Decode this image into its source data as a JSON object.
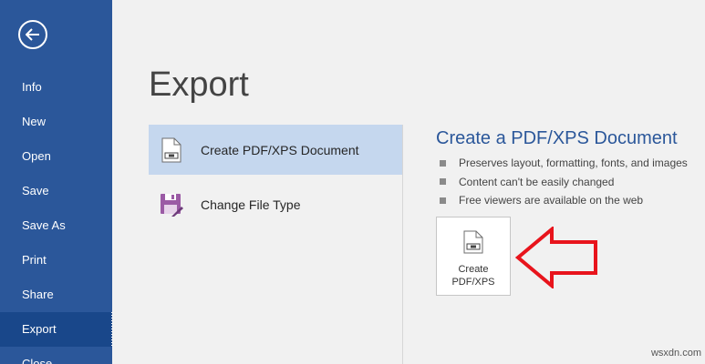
{
  "sidebar": {
    "items": [
      {
        "label": "Info"
      },
      {
        "label": "New"
      },
      {
        "label": "Open"
      },
      {
        "label": "Save"
      },
      {
        "label": "Save As"
      },
      {
        "label": "Print"
      },
      {
        "label": "Share"
      },
      {
        "label": "Export"
      },
      {
        "label": "Close"
      }
    ],
    "active": "Export"
  },
  "main": {
    "title": "Export",
    "options": [
      {
        "label": "Create PDF/XPS Document",
        "icon": "pdf-document-icon"
      },
      {
        "label": "Change File Type",
        "icon": "change-file-type-icon"
      }
    ]
  },
  "detail": {
    "title": "Create a PDF/XPS Document",
    "bullets": [
      "Preserves layout, formatting, fonts, and images",
      "Content can't be easily changed",
      "Free viewers are available on the web"
    ],
    "button": {
      "line1": "Create",
      "line2": "PDF/XPS"
    }
  },
  "watermark": "wsxdn.com",
  "colors": {
    "sidebar": "#2b579a",
    "sidebar_active": "#19478a",
    "selected_option": "#c5d7ee",
    "accent_arrow": "#e8141c",
    "detail_title": "#2b579a"
  }
}
